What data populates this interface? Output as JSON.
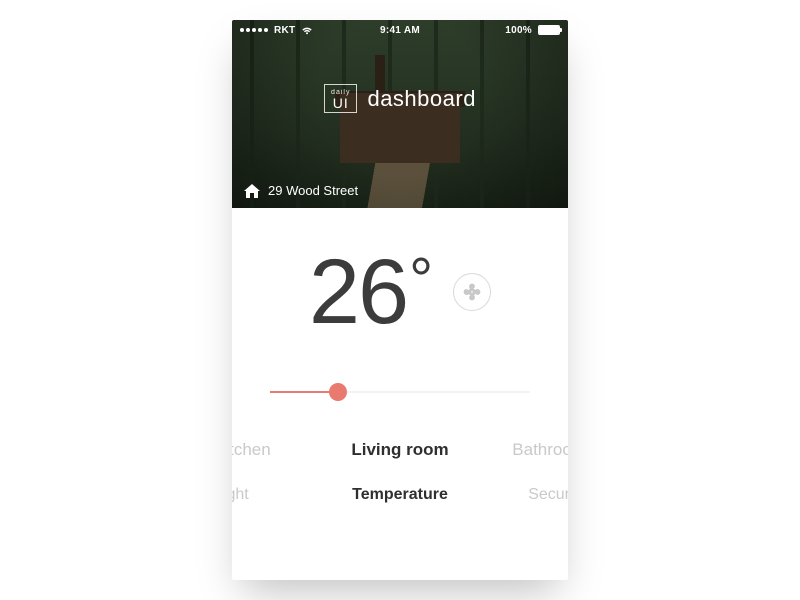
{
  "statusbar": {
    "carrier": "RKT",
    "time": "9:41 AM",
    "battery_pct": "100%"
  },
  "brand": {
    "logo_line1": "daily",
    "logo_line2": "UI",
    "title": "dashboard"
  },
  "address": {
    "text": "29 Wood Street"
  },
  "temperature": {
    "value": "26",
    "unit": "°",
    "slider_pct": 26
  },
  "rooms": {
    "prev": "Kitchen",
    "active": "Living room",
    "next": "Bathroom"
  },
  "categories": {
    "prev": "Light",
    "active": "Temperature",
    "next": "Security"
  },
  "colors": {
    "accent": "#e97a6f"
  }
}
